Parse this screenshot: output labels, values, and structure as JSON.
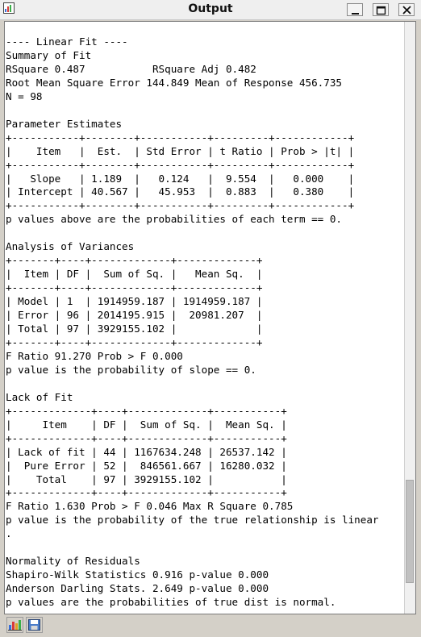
{
  "window": {
    "title": "Output"
  },
  "titlebar_buttons": [
    {
      "name": "minimize-button",
      "icon": "minimize-icon"
    },
    {
      "name": "maximize-button",
      "icon": "maximize-icon"
    },
    {
      "name": "close-button",
      "icon": "close-icon"
    }
  ],
  "output_text": "---- Linear Fit ----\nSummary of Fit\nRSquare 0.487           RSquare Adj 0.482\nRoot Mean Square Error 144.849 Mean of Response 456.735\nN = 98\n\nParameter Estimates\n+-----------+--------+-----------+---------+------------+\n|    Item   |  Est.  | Std Error | t Ratio | Prob > |t| |\n+-----------+--------+-----------+---------+------------+\n|   Slope   | 1.189  |   0.124   |  9.554  |   0.000    |\n| Intercept | 40.567 |   45.953  |  0.883  |   0.380    |\n+-----------+--------+-----------+---------+------------+\np values above are the probabilities of each term == 0.\n\nAnalysis of Variances\n+-------+----+-------------+-------------+\n|  Item | DF |  Sum of Sq. |   Mean Sq.  |\n+-------+----+-------------+-------------+\n| Model | 1  | 1914959.187 | 1914959.187 |\n| Error | 96 | 2014195.915 |  20981.207  |\n| Total | 97 | 3929155.102 |             |\n+-------+----+-------------+-------------+\nF Ratio 91.270 Prob > F 0.000\np value is the probability of slope == 0.\n\nLack of Fit\n+-------------+----+-------------+-----------+\n|     Item    | DF |  Sum of Sq. |  Mean Sq. |\n+-------------+----+-------------+-----------+\n| Lack of fit | 44 | 1167634.248 | 26537.142 |\n|  Pure Error | 52 |  846561.667 | 16280.032 |\n|    Total    | 97 | 3929155.102 |           |\n+-------------+----+-------------+-----------+\nF Ratio 1.630 Prob > F 0.046 Max R Square 0.785\np value is the probability of the true relationship is linear\n.\n\nNormality of Residuals\nShapiro-Wilk Statistics 0.916 p-value 0.000\nAnderson Darling Stats. 2.649 p-value 0.000\np values are the probabilities of true dist is normal.",
  "statusbar": {
    "buttons": [
      "chart-icon",
      "save-icon"
    ]
  }
}
